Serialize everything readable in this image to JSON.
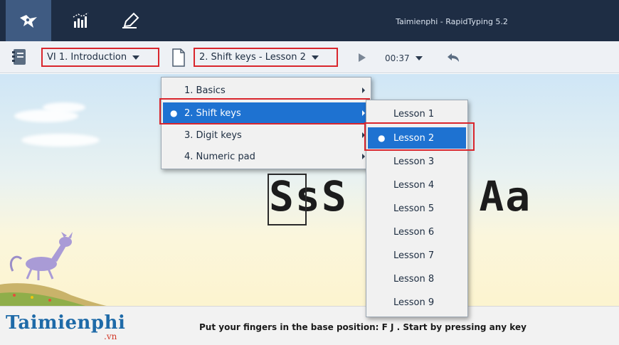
{
  "window": {
    "title": "Taimienphi - RapidTyping 5.2"
  },
  "titlebar": {
    "tabs": [
      {
        "name": "lesson-tab",
        "icon": "typing-hero-icon",
        "active": true
      },
      {
        "name": "statistics-tab",
        "icon": "bar-chart-icon",
        "active": false
      },
      {
        "name": "editor-tab",
        "icon": "pencil-icon",
        "active": false
      }
    ]
  },
  "toolbar": {
    "course_label": "VI 1. Introduction",
    "lesson_label": "2. Shift keys - Lesson 2",
    "timer": "00:37"
  },
  "lesson": {
    "typed_text": "SsS  lL Aa"
  },
  "sections_menu": {
    "items": [
      {
        "label": "1. Basics",
        "selected": false,
        "has_submenu": true
      },
      {
        "label": "2. Shift keys",
        "selected": true,
        "has_submenu": true
      },
      {
        "label": "3. Digit keys",
        "selected": false,
        "has_submenu": true
      },
      {
        "label": "4. Numeric pad",
        "selected": false,
        "has_submenu": true
      }
    ]
  },
  "lessons_menu": {
    "items": [
      {
        "label": "Lesson 1",
        "selected": false
      },
      {
        "label": "Lesson 2",
        "selected": true
      },
      {
        "label": "Lesson 3",
        "selected": false
      },
      {
        "label": "Lesson 4",
        "selected": false
      },
      {
        "label": "Lesson 5",
        "selected": false
      },
      {
        "label": "Lesson 6",
        "selected": false
      },
      {
        "label": "Lesson 7",
        "selected": false
      },
      {
        "label": "Lesson 8",
        "selected": false
      },
      {
        "label": "Lesson 9",
        "selected": false
      }
    ]
  },
  "footer": {
    "brand": "Taimienphi",
    "brand_suffix": ".vn",
    "instruction": "Put your fingers in the base position:  F  J .  Start by pressing any key"
  },
  "colors": {
    "accent": "#1e72d1",
    "highlight_frame": "#d9262d",
    "titlebar": "#1e2d44"
  }
}
